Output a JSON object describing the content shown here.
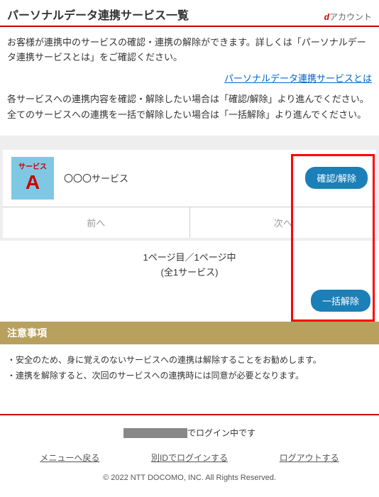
{
  "header": {
    "title": "パーソナルデータ連携サービス一覧",
    "brand_prefix": "d",
    "brand_suffix": "アカウント"
  },
  "intro": "お客様が連携中のサービスの確認・連携の解除ができます。詳しくは「パーソナルデータ連携サービスとは」をご確認ください。",
  "info_link": "パーソナルデータ連携サービスとは",
  "desc1": "各サービスへの連携内容を確認・解除したい場合は「確認/解除」より進んでください。",
  "desc2": "全てのサービスへの連携を一括で解除したい場合は「一括解除」より進んでください。",
  "service": {
    "icon_top": "サービス",
    "icon_letter": "A",
    "name": "〇〇〇サービス",
    "confirm_btn": "確認/解除"
  },
  "pager": {
    "prev": "前へ",
    "next": "次へ"
  },
  "page_info_line1": "1ページ目／1ページ中",
  "page_info_line2": "(全1サービス)",
  "bulk_btn": "一括解除",
  "notes_header": "注意事項",
  "notes": [
    "・安全のため、身に覚えのないサービスへの連携は解除することをお勧めします。",
    "・連携を解除すると、次回のサービスへの連携時には同意が必要となります。"
  ],
  "login_status_suffix": "でログイン中です",
  "footer_links": {
    "menu": "メニューへ戻る",
    "other_id": "別IDでログインする",
    "logout": "ログアウトする"
  },
  "copyright": "© 2022 NTT DOCOMO, INC. All Rights Reserved."
}
